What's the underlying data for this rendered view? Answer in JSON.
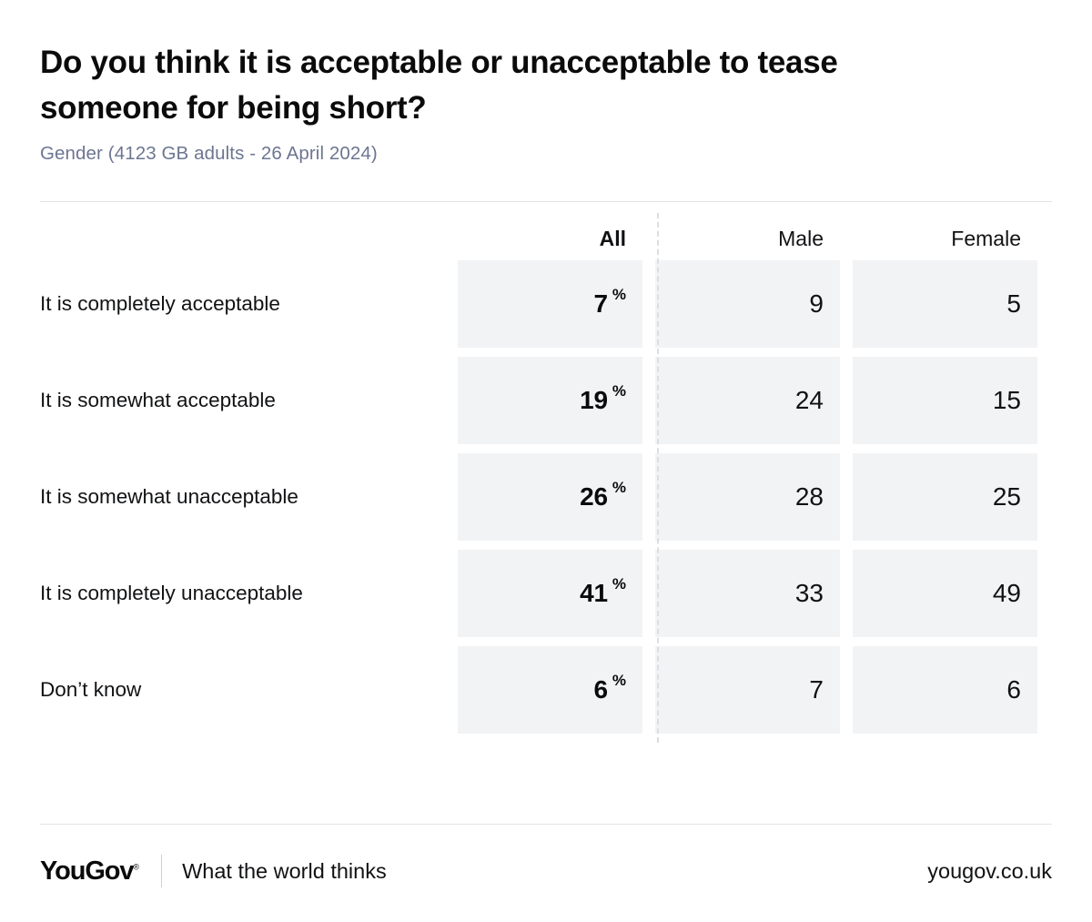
{
  "header": {
    "title": "Do you think it is acceptable or unacceptable to tease someone for being short?",
    "subtitle": "Gender (4123 GB adults - 26 April 2024)"
  },
  "chart_data": {
    "type": "table",
    "title": "Do you think it is acceptable or unacceptable to tease someone for being short?",
    "subtitle": "Gender (4123 GB adults - 26 April 2024)",
    "columns": [
      "",
      "All",
      "Male",
      "Female"
    ],
    "percent_symbol": "%",
    "rows": [
      {
        "label": "It is completely acceptable",
        "all": "7",
        "male": "9",
        "female": "5"
      },
      {
        "label": "It is somewhat acceptable",
        "all": "19",
        "male": "24",
        "female": "15"
      },
      {
        "label": "It is somewhat unacceptable",
        "all": "26",
        "male": "28",
        "female": "25"
      },
      {
        "label": "It is completely unacceptable",
        "all": "41",
        "male": "33",
        "female": "49"
      },
      {
        "label": "Don’t know",
        "all": "6",
        "male": "7",
        "female": "6"
      }
    ],
    "units": "percent",
    "sample_size": 4123,
    "population": "GB adults",
    "fieldwork_date": "26 April 2024",
    "breakdown": "Gender",
    "colors": {
      "cell_background": "#f2f3f5",
      "text": "#111214",
      "subtitle": "#6d7691",
      "rule": "#e3e4e8",
      "divider": "#dcdee2"
    }
  },
  "footer": {
    "logo": "YouGov",
    "registered_mark": "®",
    "tagline": "What the world thinks",
    "site": "yougov.co.uk"
  }
}
